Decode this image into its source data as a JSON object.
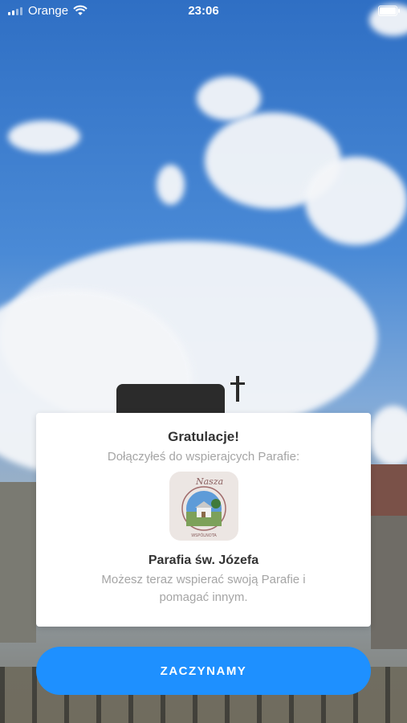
{
  "status_bar": {
    "carrier": "Orange",
    "time": "23:06",
    "icons": [
      "signal-icon",
      "wifi-icon",
      "battery-icon"
    ]
  },
  "card": {
    "title": "Gratulacje!",
    "subtitle": "Dołączyłeś do wspierajcych Parafie:",
    "logo": {
      "icon": "parish-logo",
      "text_top": "Nasza",
      "text_bottom": "WSPÓLNOTA"
    },
    "parish_name": "Parafia św. Józefa",
    "message": "Możesz teraz wspierać swoją Parafie i pomagać innym."
  },
  "button": {
    "label": "ZACZYNAMY",
    "color": "#1e90ff"
  }
}
